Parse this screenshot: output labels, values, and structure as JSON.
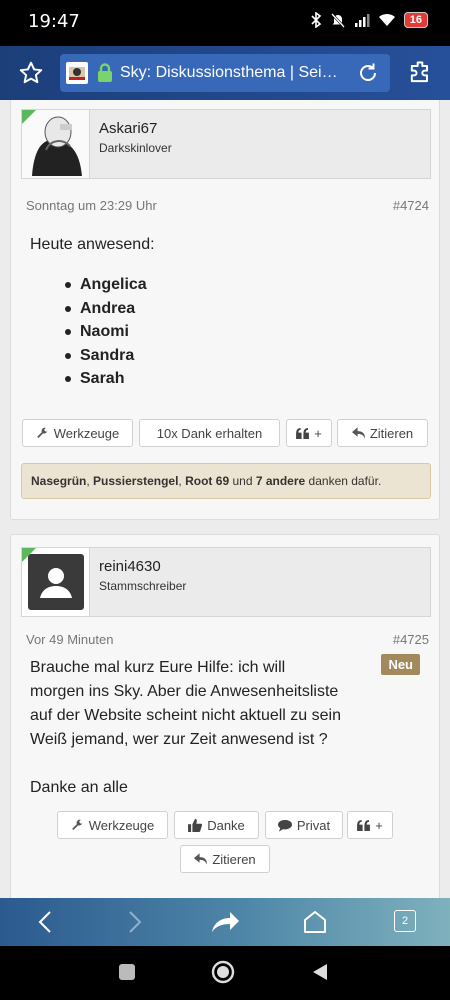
{
  "status": {
    "time": "19:47",
    "battery": "16"
  },
  "browser": {
    "url_title": "Sky: Diskussionsthema | Sei…",
    "tab_count": "2"
  },
  "posts": [
    {
      "username": "Askari67",
      "user_title": "Darkskinlover",
      "date": "Sonntag um 23:29 Uhr",
      "number": "#4724",
      "intro": "Heute anwesend:",
      "list": [
        "Angelica",
        "Andrea",
        "Naomi",
        "Sandra",
        "Sarah"
      ],
      "buttons": {
        "tools": "Werkzeuge",
        "thanks_count": "10x Dank erhalten",
        "multiquote": "+",
        "quote": "Zitieren"
      },
      "likes": {
        "names": [
          "Nasegrün",
          "Pussierstengel",
          "Root 69"
        ],
        "sep": ",",
        "and": "und",
        "others": "7 andere",
        "suffix": "danken dafür."
      }
    },
    {
      "username": "reini4630",
      "user_title": "Stammschreiber",
      "date": "Vor 49 Minuten",
      "number": "#4725",
      "badge": "Neu",
      "text_lines": [
        "Brauche mal kurz Eure Hilfe: ich will",
        "morgen ins Sky. Aber die Anwesenheitsliste",
        "auf der Website scheint nicht aktuell zu sein",
        "Weiß jemand, wer zur Zeit anwesend ist ?",
        "",
        "Danke an alle"
      ],
      "buttons": {
        "tools": "Werkzeuge",
        "thanks": "Danke",
        "private": "Privat",
        "multiquote": "+",
        "quote": "Zitieren"
      }
    }
  ],
  "colors": {
    "toolbar": "#1c3f7a",
    "online_indicator": "#5cb85c",
    "badge": "#a08a5e",
    "likes_bg": "#ece4d2"
  }
}
